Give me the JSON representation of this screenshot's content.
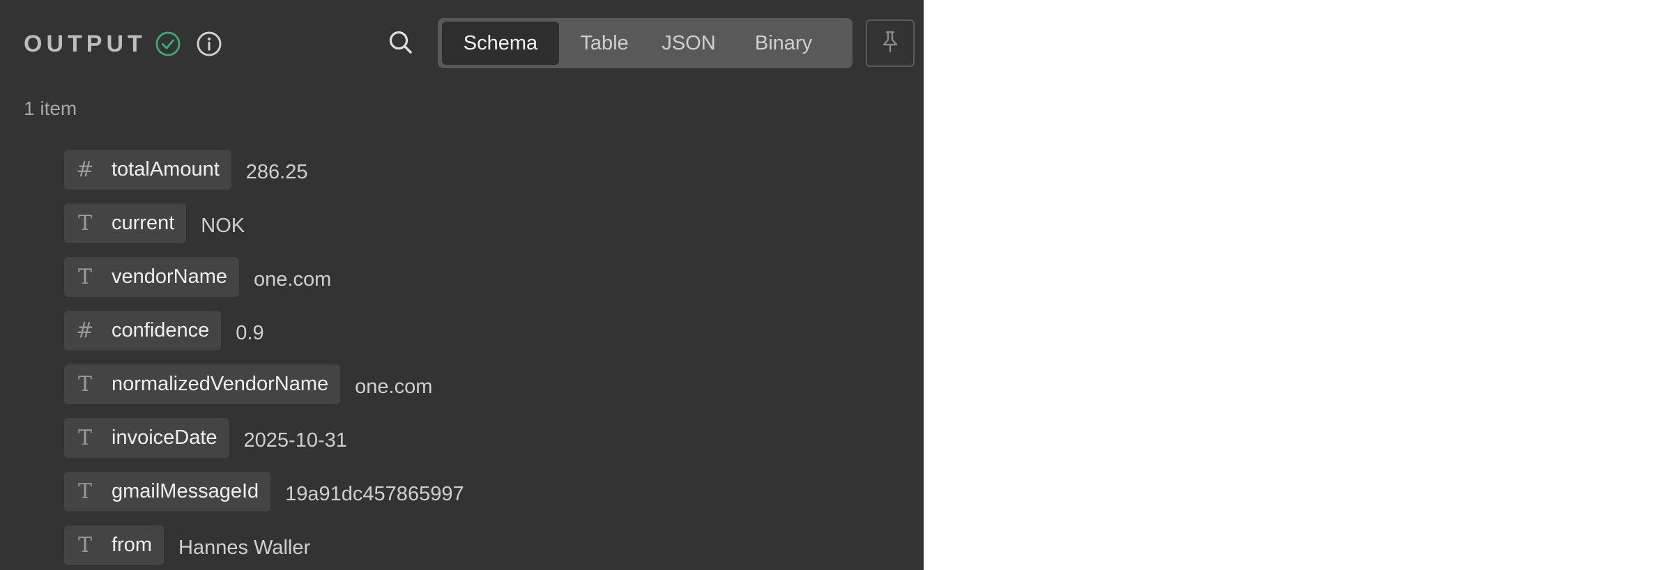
{
  "header": {
    "title": "OUTPUT",
    "status_icon": "check-circle-icon",
    "status_color": "#3aa76d",
    "info_icon": "info-icon",
    "search_icon": "search-icon",
    "pin_icon": "pin-icon"
  },
  "tabs": [
    {
      "label": "Schema",
      "active": true
    },
    {
      "label": "Table",
      "active": false
    },
    {
      "label": "JSON",
      "active": false
    },
    {
      "label": "Binary",
      "active": false
    }
  ],
  "item_count": "1 item",
  "fields": [
    {
      "type": "number",
      "icon": "#",
      "name": "totalAmount",
      "value": "286.25"
    },
    {
      "type": "string",
      "icon": "T",
      "name": "current",
      "value": "NOK"
    },
    {
      "type": "string",
      "icon": "T",
      "name": "vendorName",
      "value": "one.com"
    },
    {
      "type": "number",
      "icon": "#",
      "name": "confidence",
      "value": "0.9"
    },
    {
      "type": "string",
      "icon": "T",
      "name": "normalizedVendorName",
      "value": "one.com"
    },
    {
      "type": "string",
      "icon": "T",
      "name": "invoiceDate",
      "value": "2025-10-31"
    },
    {
      "type": "string",
      "icon": "T",
      "name": "gmailMessageId",
      "value": "19a91dc457865997"
    },
    {
      "type": "string",
      "icon": "T",
      "name": "from",
      "value": "Hannes Waller"
    }
  ],
  "colors": {
    "panel_bg": "#333333",
    "pill_bg": "#444444",
    "tabs_bg": "#595959",
    "active_tab_bg": "#2e2e2e"
  }
}
